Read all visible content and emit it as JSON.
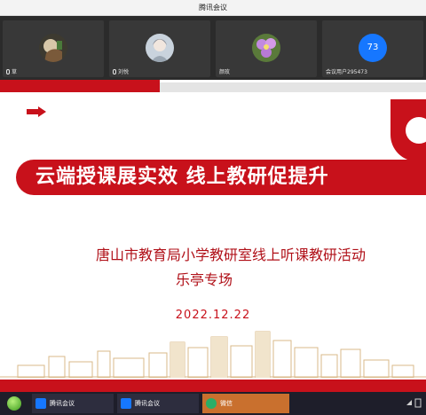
{
  "window": {
    "title": "腾讯会议"
  },
  "participants": [
    {
      "name": "草",
      "muted_icon": "microphone-icon"
    },
    {
      "name": "刘悦",
      "muted_icon": "microphone-icon"
    },
    {
      "name": "颜玫",
      "muted_icon": ""
    },
    {
      "name": "会议用户295473",
      "muted_icon": "",
      "avatar_text": "73"
    }
  ],
  "slide": {
    "banner": "云端授课展实效  线上教研促提升",
    "subtitle": "唐山市教育局小学教研室线上听课教研活动",
    "session": "乐亭专场",
    "date": "2022.12.22"
  },
  "taskbar": {
    "items": [
      {
        "label": "腾讯会议",
        "icon": "tencent-meeting-icon"
      },
      {
        "label": "腾讯会议",
        "icon": "tencent-meeting-icon"
      },
      {
        "label": "微信",
        "icon": "wechat-icon"
      }
    ]
  },
  "colors": {
    "brand_red": "#c8111b",
    "strip": "#2b2b2b",
    "taskbar": "#1e1e2a",
    "meeting_blue": "#1677ff",
    "wechat_tab": "#c9702e"
  }
}
